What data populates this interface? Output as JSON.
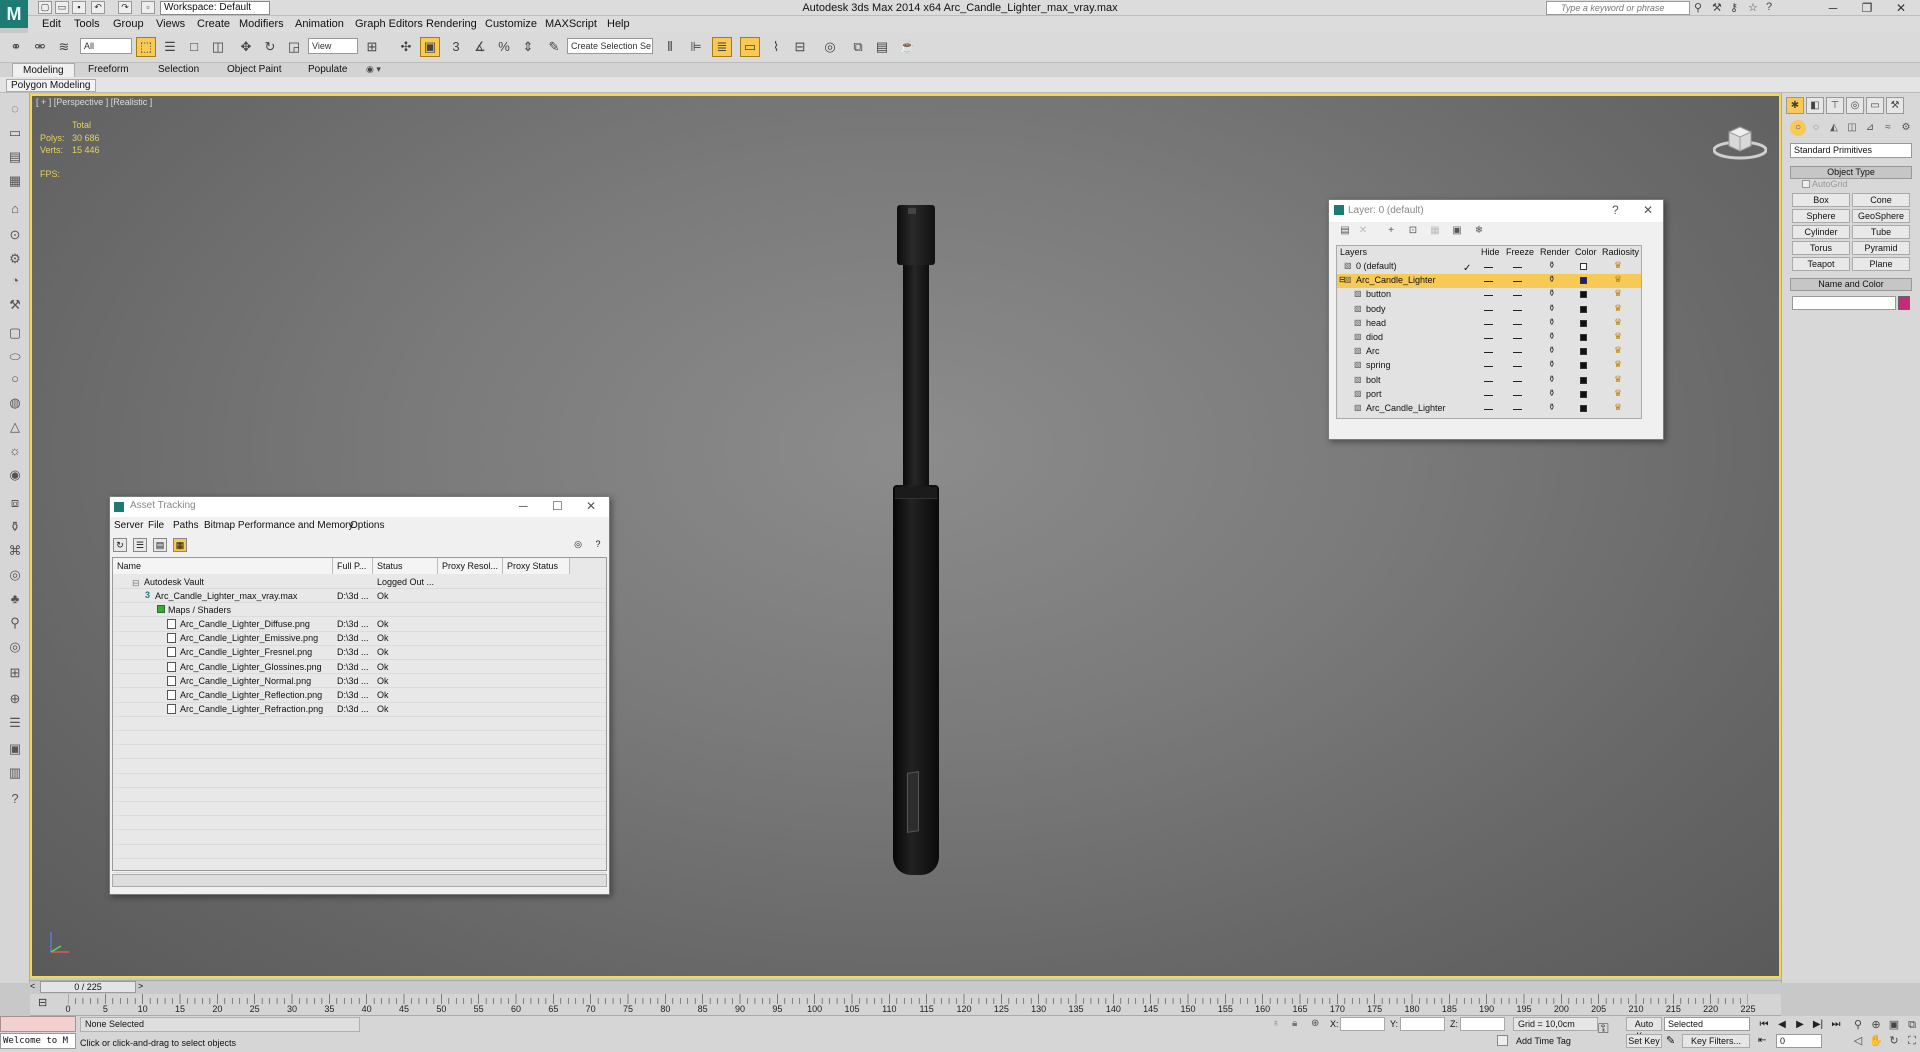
{
  "titlebar": {
    "logo": "M",
    "workspace": "Workspace: Default",
    "title": "Autodesk 3ds Max  2014 x64    Arc_Candle_Lighter_max_vray.max",
    "search_placeholder": "Type a keyword or phrase",
    "minimize": "─",
    "maximize": "❐",
    "close": "✕"
  },
  "menu": [
    "Edit",
    "Tools",
    "Group",
    "Views",
    "Create",
    "Modifiers",
    "Animation",
    "Graph Editors",
    "Rendering",
    "Customize",
    "MAXScript",
    "Help"
  ],
  "toolbar": {
    "selection_filter": "All",
    "ref_coord": "View",
    "named_selection": "Create Selection Se"
  },
  "ribbon": {
    "tabs": [
      "Modeling",
      "Freeform",
      "Selection",
      "Object Paint",
      "Populate"
    ],
    "sub_label": "Polygon Modeling"
  },
  "viewport": {
    "label": "[ + ] [Perspective ] [Realistic ]",
    "stats_total": "Total",
    "polys_label": "Polys:",
    "polys_value": "30 686",
    "verts_label": "Verts:",
    "verts_value": "15 446",
    "fps_label": "FPS:"
  },
  "command_panel": {
    "dropdown": "Standard Primitives",
    "object_type": "Object Type",
    "autogrid": "AutoGrid",
    "primitives": [
      "Box",
      "Cone",
      "Sphere",
      "GeoSphere",
      "Cylinder",
      "Tube",
      "Torus",
      "Pyramid",
      "Teapot",
      "Plane"
    ],
    "name_and_color": "Name and Color",
    "object_color": "#c8287a"
  },
  "layer_dialog": {
    "title": "Layer: 0 (default)",
    "help": "?",
    "close": "✕",
    "headers": {
      "layers": "Layers",
      "hide": "Hide",
      "freeze": "Freeze",
      "render": "Render",
      "color": "Color",
      "radiosity": "Radiosity"
    },
    "rows": [
      {
        "name": "0 (default)",
        "color": "#ffffff"
      },
      {
        "name": "Arc_Candle_Lighter",
        "color": "#1a1a8c"
      },
      {
        "name": "button",
        "color": "#111111"
      },
      {
        "name": "body",
        "color": "#111111"
      },
      {
        "name": "head",
        "color": "#111111"
      },
      {
        "name": "diod",
        "color": "#111111"
      },
      {
        "name": "Arc",
        "color": "#111111"
      },
      {
        "name": "spring",
        "color": "#111111"
      },
      {
        "name": "bolt",
        "color": "#111111"
      },
      {
        "name": "port",
        "color": "#111111"
      },
      {
        "name": "Arc_Candle_Lighter",
        "color": "#111111"
      }
    ],
    "active_check": "✓"
  },
  "asset_dialog": {
    "title": "Asset Tracking",
    "menu": [
      "Server",
      "File",
      "Paths",
      "Bitmap Performance and Memory",
      "Options"
    ],
    "columns": [
      "Name",
      "Full P...",
      "Status",
      "Proxy Resol...",
      "Proxy Status"
    ],
    "vault": {
      "name": "Autodesk Vault",
      "status": "Logged Out ..."
    },
    "scene": {
      "name": "Arc_Candle_Lighter_max_vray.max",
      "path": "D:\\3d ...",
      "status": "Ok"
    },
    "maps_group": "Maps / Shaders",
    "files": [
      {
        "name": "Arc_Candle_Lighter_Diffuse.png",
        "path": "D:\\3d ...",
        "status": "Ok"
      },
      {
        "name": "Arc_Candle_Lighter_Emissive.png",
        "path": "D:\\3d ...",
        "status": "Ok"
      },
      {
        "name": "Arc_Candle_Lighter_Fresnel.png",
        "path": "D:\\3d ...",
        "status": "Ok"
      },
      {
        "name": "Arc_Candle_Lighter_Glossines.png",
        "path": "D:\\3d ...",
        "status": "Ok"
      },
      {
        "name": "Arc_Candle_Lighter_Normal.png",
        "path": "D:\\3d ...",
        "status": "Ok"
      },
      {
        "name": "Arc_Candle_Lighter_Reflection.png",
        "path": "D:\\3d ...",
        "status": "Ok"
      },
      {
        "name": "Arc_Candle_Lighter_Refraction.png",
        "path": "D:\\3d ...",
        "status": "Ok"
      }
    ]
  },
  "timeline": {
    "slider": "0 / 225",
    "ticks": [
      "0",
      "5",
      "10",
      "15",
      "20",
      "25",
      "30",
      "35",
      "40",
      "45",
      "50",
      "55",
      "60",
      "65",
      "70",
      "75",
      "80",
      "85",
      "90",
      "95",
      "100",
      "105",
      "110",
      "115",
      "120",
      "125",
      "130",
      "135",
      "140",
      "145",
      "150",
      "155",
      "160",
      "165",
      "170",
      "175",
      "180",
      "185",
      "190",
      "195",
      "200",
      "205",
      "210",
      "215",
      "220",
      "225"
    ]
  },
  "status": {
    "listener": "Welcome to M",
    "selection": "None Selected",
    "prompt": "Click or click-and-drag to select objects",
    "x_label": "X:",
    "y_label": "Y:",
    "z_label": "Z:",
    "grid": "Grid = 10,0cm",
    "add_time_tag": "Add Time Tag",
    "auto_key": "Auto Key",
    "set_key": "Set Key",
    "selected": "Selected",
    "key_filters": "Key Filters...",
    "frame": "0"
  }
}
